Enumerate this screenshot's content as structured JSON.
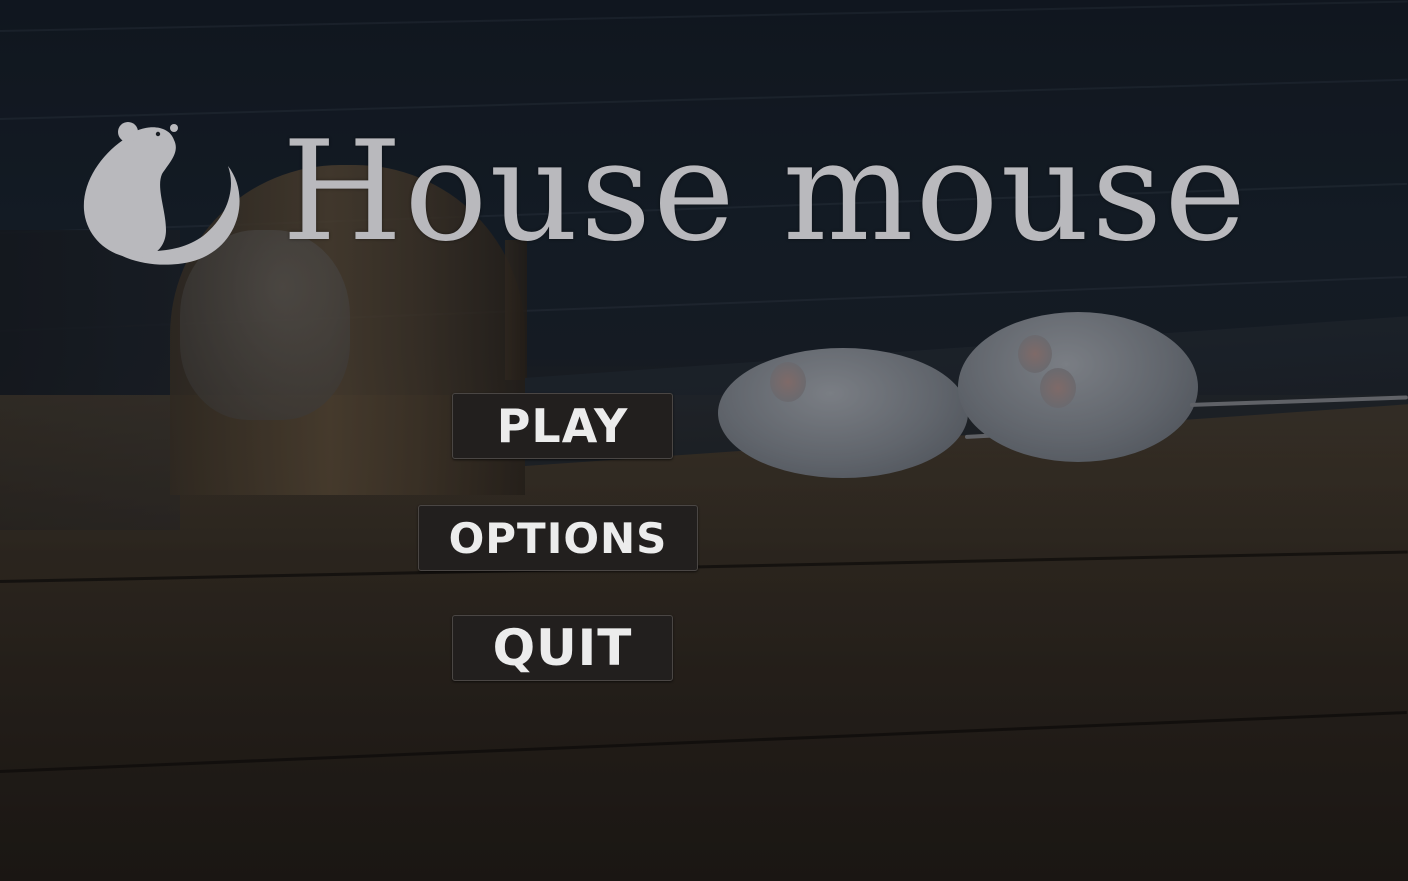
{
  "game": {
    "title": "House mouse",
    "logo_icon": "mouse-silhouette-icon"
  },
  "menu": {
    "play_label": "PLAY",
    "options_label": "OPTIONS",
    "quit_label": "QUIT"
  },
  "colors": {
    "title_text": "#b9b9bd",
    "button_bg": "#221f1e",
    "button_text": "#ececec"
  }
}
